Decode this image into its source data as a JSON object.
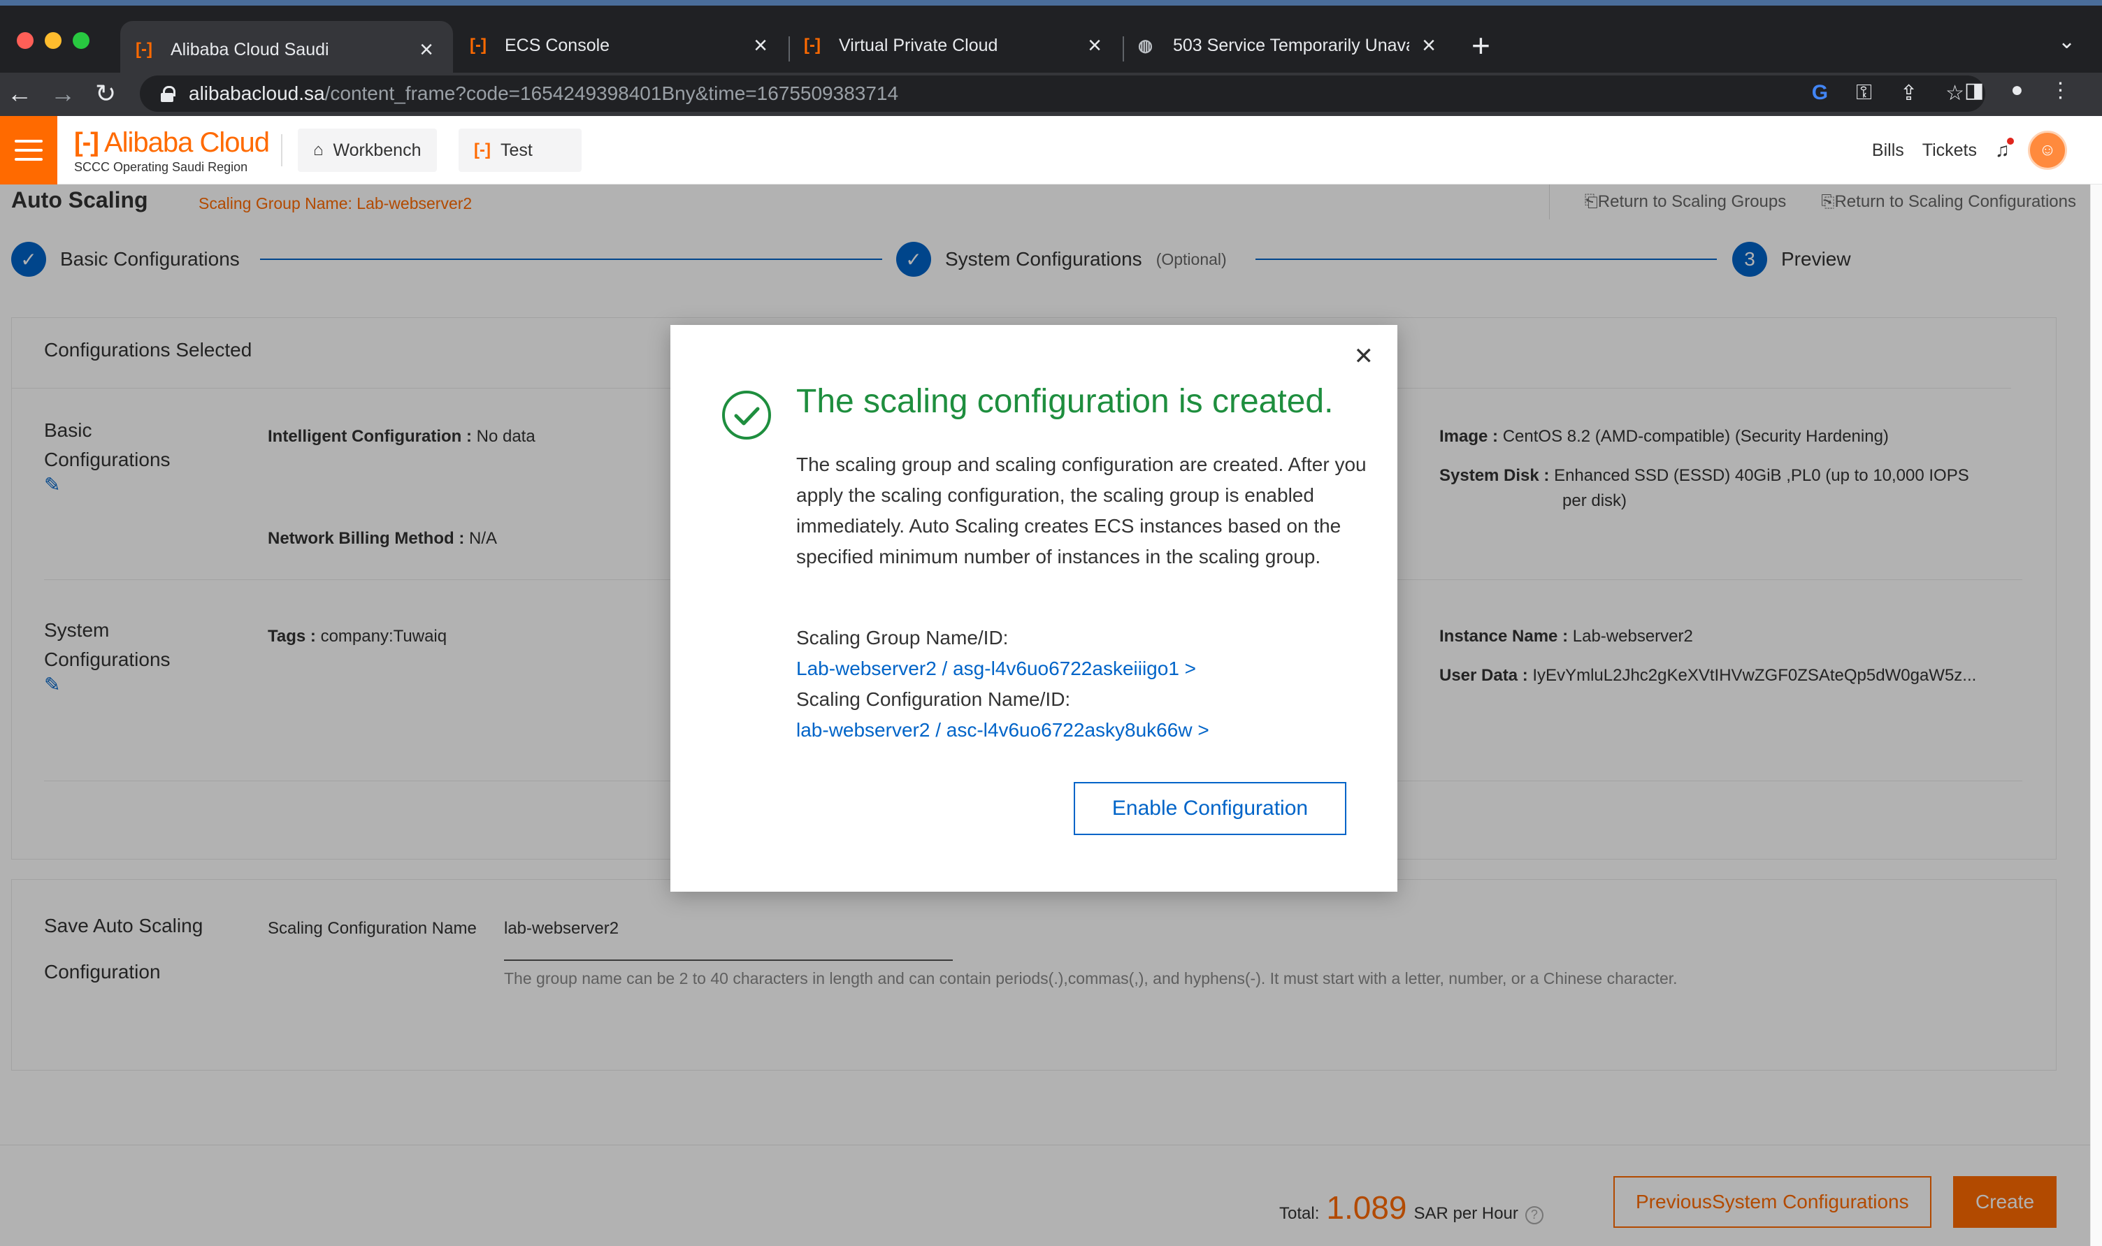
{
  "browser": {
    "tabs": [
      {
        "label": "Alibaba Cloud Saudi",
        "icon": "alibaba-logo-icon"
      },
      {
        "label": "ECS Console",
        "icon": "alibaba-logo-icon"
      },
      {
        "label": "Virtual Private Cloud",
        "icon": "alibaba-logo-icon"
      },
      {
        "label": "503 Service Temporarily Unava",
        "icon": "globe-icon"
      }
    ],
    "url_host": "alibabacloud.sa",
    "url_path": "/content_frame?code=1654249398401Bny&time=1675509383714"
  },
  "header": {
    "brand": "Alibaba Cloud",
    "region": "SCCC Operating Saudi Region",
    "workbench": "Workbench",
    "test": "Test",
    "bills": "Bills",
    "tickets": "Tickets"
  },
  "page": {
    "title": "Auto Scaling",
    "group_name": "Scaling Group Name: Lab-webserver2",
    "return_groups": "Return to Scaling Groups",
    "return_configs": "Return to Scaling Configurations"
  },
  "steps": {
    "basic": "Basic Configurations",
    "system": "System Configurations",
    "optional": "(Optional)",
    "preview_num": "3",
    "preview": "Preview"
  },
  "configs": {
    "heading": "Configurations Selected",
    "basic_label": "Basic Configurations",
    "system_label": "System Configurations",
    "intelligent_key": "Intelligent Configuration :",
    "intelligent_val": "No data",
    "network_key": "Network Billing Method :",
    "network_val": "N/A",
    "image_key": "Image :",
    "image_val": "CentOS 8.2 (AMD-compatible)  (Security Hardening)",
    "disk_key": "System Disk :",
    "disk_val_1": "Enhanced SSD (ESSD) 40GiB ,PL0 (up to 10,000 IOPS",
    "disk_val_2": "per disk)",
    "tags_key": "Tags :",
    "tags_val": "company:Tuwaiq",
    "instance_key": "Instance Name :",
    "instance_val": "Lab-webserver2",
    "userdata_key": "User Data :",
    "userdata_val": "IyEvYmluL2Jhc2gKeXVtIHVwZGF0ZSAteQp5dW0gaW5z..."
  },
  "save": {
    "label_1": "Save Auto Scaling",
    "label_2": "Configuration",
    "field_label": "Scaling Configuration Name",
    "field_value": "lab-webserver2",
    "hint": "The group name can be 2 to 40 characters in length and can contain periods(.),commas(,), and hyphens(-). It must start with a letter, number, or a Chinese character."
  },
  "footer": {
    "total_label": "Total:",
    "amount": "1.089",
    "unit": "SAR per Hour",
    "help": "?",
    "previous": "PreviousSystem Configurations",
    "create": "Create"
  },
  "modal": {
    "title": "The scaling configuration is created.",
    "body": "The scaling group and scaling configuration are created. After you apply the scaling configuration, the scaling group is enabled immediately. Auto Scaling creates ECS instances based on the specified minimum number of instances in the scaling group.",
    "group_label": "Scaling Group Name/ID:",
    "group_link": "Lab-webserver2 / asg-l4v6uo6722askeiiigo1 >",
    "config_label": "Scaling Configuration Name/ID:",
    "config_link": "lab-webserver2 / asc-l4v6uo6722asky8uk66w >",
    "enable": "Enable Configuration"
  },
  "colors": {
    "brand_orange": "#ff6a00",
    "primary_blue": "#0064c8",
    "success_green": "#1e8e3e"
  }
}
